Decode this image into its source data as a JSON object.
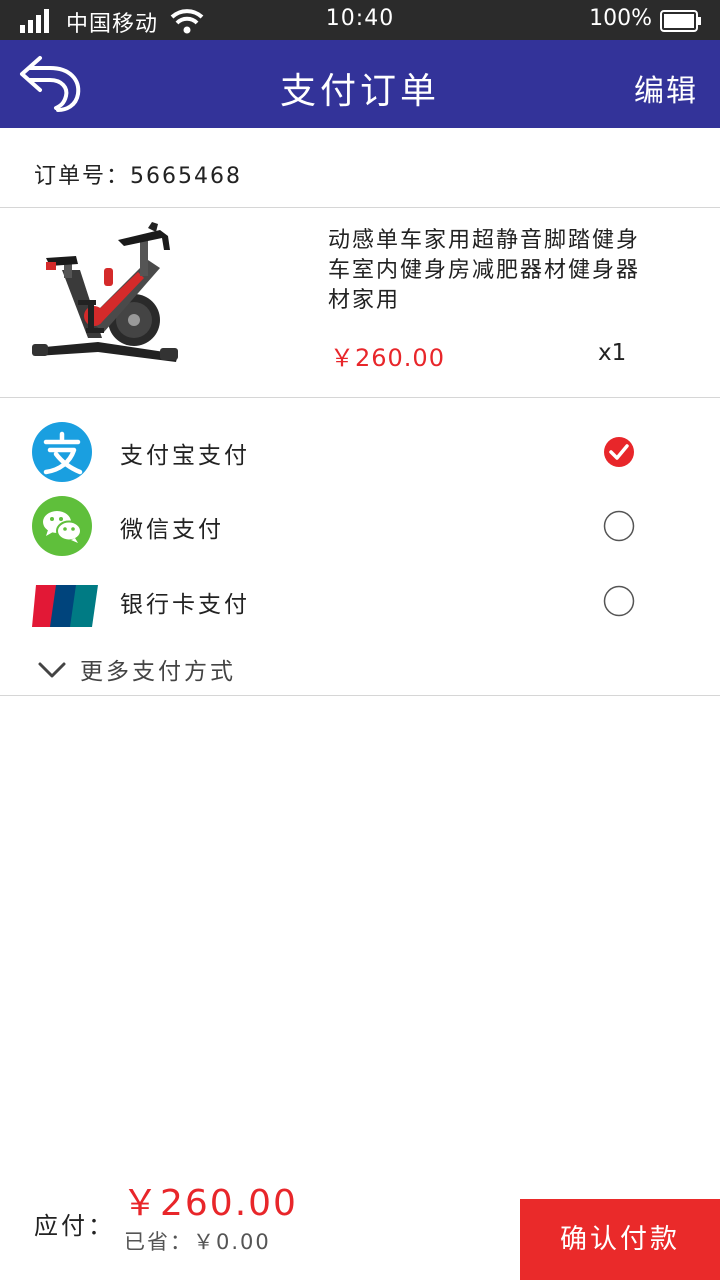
{
  "status_bar": {
    "carrier": "中国移动",
    "time": "10:40",
    "battery": "100%"
  },
  "header": {
    "title": "支付订单",
    "edit_label": "编辑"
  },
  "order": {
    "label": "订单号：5665468"
  },
  "product": {
    "name": "动感单车家用超静音脚踏健身车室内健身房减肥器材健身器材家用",
    "price": "￥260.00",
    "quantity": "x1"
  },
  "payment_methods": [
    {
      "label": "支付宝支付",
      "selected": true
    },
    {
      "label": "微信支付",
      "selected": false
    },
    {
      "label": "银行卡支付",
      "selected": false
    }
  ],
  "more_methods_label": "更多支付方式",
  "footer": {
    "pay_label": "应付：",
    "total": "￥260.00",
    "saved": "已省：￥0.00",
    "confirm_label": "确认付款"
  },
  "colors": {
    "header_bg": "#333399",
    "accent_red": "#e8262a",
    "alipay_blue": "#1a9fe0",
    "wechat_green": "#5fbf3b"
  }
}
